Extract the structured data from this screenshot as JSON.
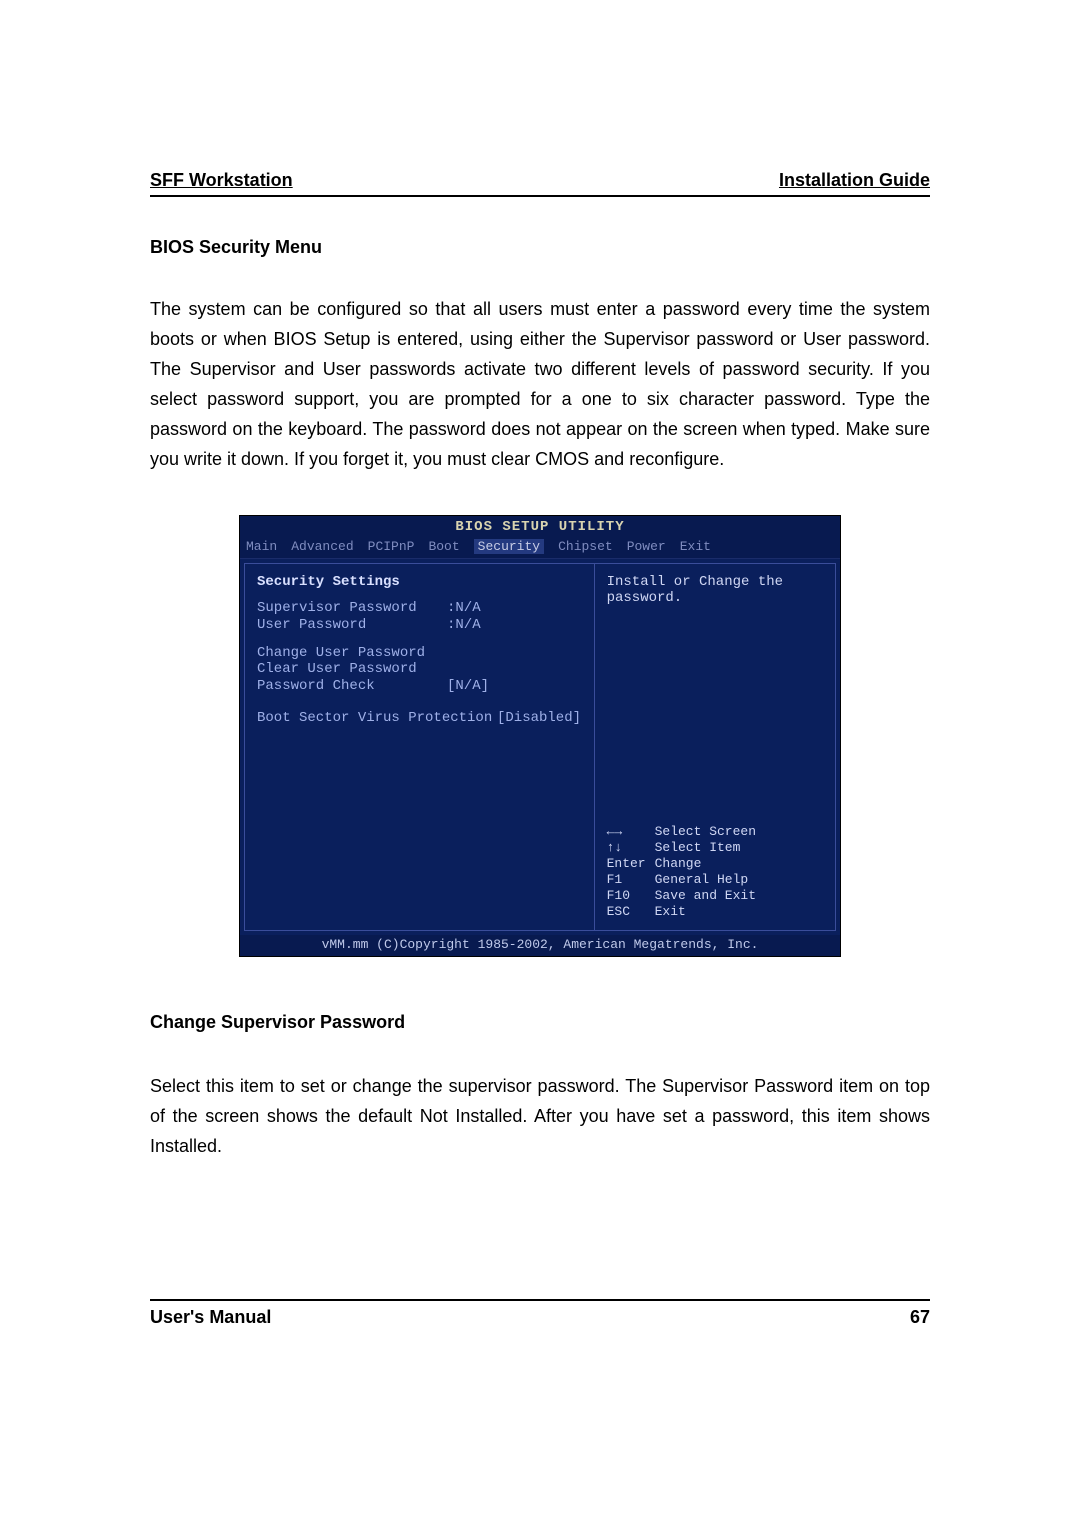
{
  "header": {
    "left": "SFF Workstation",
    "right": "Installation Guide"
  },
  "section_title": "BIOS Security Menu",
  "para1": "The system can be configured so that all users must enter a password every time the system boots or when BIOS Setup is entered, using either the Supervisor password or User password. The Supervisor and User passwords activate two different levels of password security. If you select password support, you are prompted for a one to six character password. Type the password on the keyboard. The password does not appear on the screen when typed. Make sure you write it down. If you forget it, you must clear CMOS and reconfigure.",
  "bios": {
    "title": "BIOS SETUP UTILITY",
    "tabs": [
      "Main",
      "Advanced",
      "PCIPnP",
      "Boot",
      "Security",
      "Chipset",
      "Power",
      "Exit"
    ],
    "selected_tab_index": 4,
    "left": {
      "heading": "Security Settings",
      "rows": [
        {
          "k": "Supervisor Password",
          "v": ":N/A"
        },
        {
          "k": "User Password",
          "v": ":N/A"
        }
      ],
      "links": [
        "Change User Password",
        "Clear User Password"
      ],
      "opts": [
        {
          "k": "Password Check",
          "v": "[N/A]"
        },
        {
          "k": "Boot Sector Virus Protection",
          "v": "[Disabled]"
        }
      ]
    },
    "right": {
      "help": "Install or Change the password.",
      "keys": [
        {
          "k": "←→",
          "v": "Select Screen"
        },
        {
          "k": "↑↓",
          "v": "Select Item"
        },
        {
          "k": "Enter",
          "v": "Change"
        },
        {
          "k": "F1",
          "v": "General Help"
        },
        {
          "k": "F10",
          "v": "Save and Exit"
        },
        {
          "k": "ESC",
          "v": "Exit"
        }
      ]
    },
    "footer": "vMM.mm (C)Copyright 1985-2002, American Megatrends, Inc."
  },
  "sub_title": "Change Supervisor Password",
  "para2": "Select this item to set or change the supervisor password. The Supervisor Password item on top of the screen shows the default Not Installed. After you have set a password, this item shows Installed.",
  "footer": {
    "left": "User's Manual",
    "right": "67"
  }
}
